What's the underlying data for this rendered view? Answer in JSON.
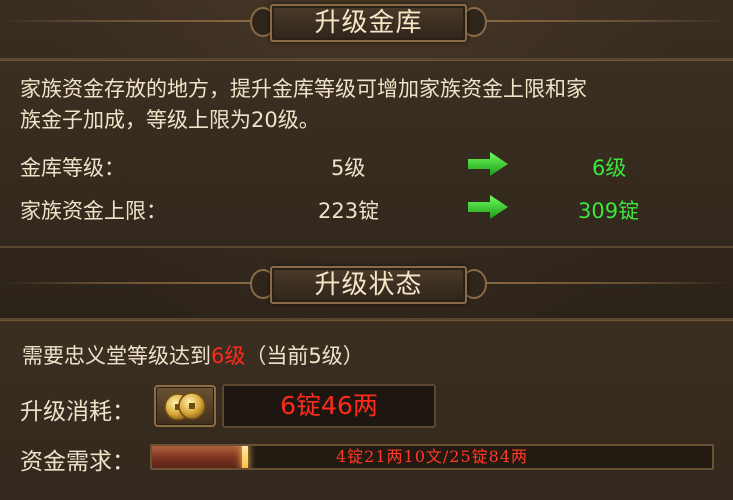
{
  "upgrade_vault": {
    "title": "升级金库",
    "description_line1": "家族资金存放的地方，提升金库等级可增加家族资金上限和家",
    "description_line2": "族金子加成，等级上限为20级。",
    "rows": [
      {
        "label": "金库等级：",
        "current": "5级",
        "next": "6级"
      },
      {
        "label": "家族资金上限：",
        "current": "223锭",
        "next": "309锭"
      }
    ]
  },
  "upgrade_status": {
    "title": "升级状态",
    "requirement_prefix": "需要忠义堂等级达到",
    "requirement_level": "6级",
    "requirement_suffix": "（当前5级）",
    "cost_label": "升级消耗：",
    "cost_value": "6锭46两",
    "funds_label": "资金需求：",
    "funds_progress_text": "4锭21两10文/25锭84两",
    "funds_progress_fraction": 0.166
  },
  "colors": {
    "accent_green": "#3ce63c",
    "alert_red": "#ff2a1c"
  },
  "icons": {
    "arrow": "green-right-arrow-icon",
    "coin": "gold-coins-icon"
  }
}
